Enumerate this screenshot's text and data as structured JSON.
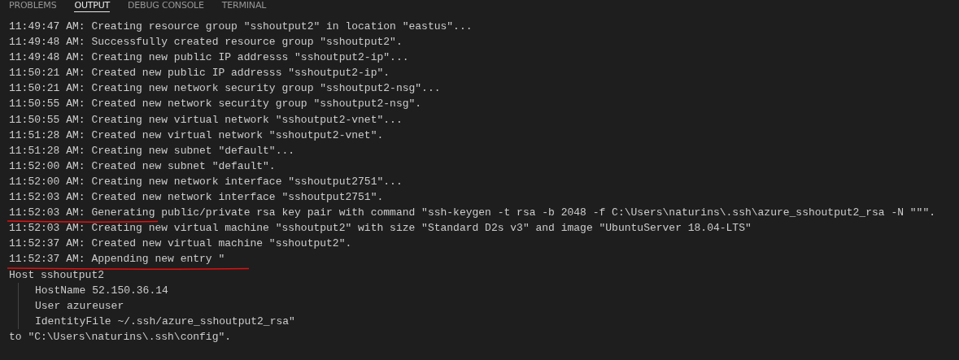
{
  "tabs": [
    {
      "label": "PROBLEMS",
      "selected": false
    },
    {
      "label": "OUTPUT",
      "selected": true
    },
    {
      "label": "DEBUG CONSOLE",
      "selected": false
    },
    {
      "label": "TERMINAL",
      "selected": false
    }
  ],
  "output": {
    "lines": [
      {
        "text": "11:49:47 AM: Creating resource group \"sshoutput2\" in location \"eastus\"...",
        "underlined": false
      },
      {
        "text": "11:49:48 AM: Successfully created resource group \"sshoutput2\".",
        "underlined": false
      },
      {
        "text": "11:49:48 AM: Creating new public IP addresss \"sshoutput2-ip\"...",
        "underlined": false
      },
      {
        "text": "11:50:21 AM: Created new public IP addresss \"sshoutput2-ip\".",
        "underlined": false
      },
      {
        "text": "11:50:21 AM: Creating new network security group \"sshoutput2-nsg\"...",
        "underlined": false
      },
      {
        "text": "11:50:55 AM: Created new network security group \"sshoutput2-nsg\".",
        "underlined": false
      },
      {
        "text": "11:50:55 AM: Creating new virtual network \"sshoutput2-vnet\"...",
        "underlined": false
      },
      {
        "text": "11:51:28 AM: Created new virtual network \"sshoutput2-vnet\".",
        "underlined": false
      },
      {
        "text": "11:51:28 AM: Creating new subnet \"default\"...",
        "underlined": false
      },
      {
        "text": "11:52:00 AM: Created new subnet \"default\".",
        "underlined": false
      },
      {
        "text": "11:52:00 AM: Creating new network interface \"sshoutput2751\"...",
        "underlined": false
      },
      {
        "text": "11:52:03 AM: Created new network interface \"sshoutput2751\".",
        "underlined": false
      },
      {
        "text": "11:52:03 AM: Generating public/private rsa key pair with command \"ssh-keygen -t rsa -b 2048 -f C:\\Users\\naturins\\.ssh\\azure_sshoutput2_rsa -N \"\"\".",
        "underlined": true
      },
      {
        "text": "11:52:03 AM: Creating new virtual machine \"sshoutput2\" with size \"Standard D2s v3\" and image \"UbuntuServer 18.04-LTS\"",
        "underlined": false
      },
      {
        "text": "11:52:37 AM: Created new virtual machine \"sshoutput2\".",
        "underlined": false
      },
      {
        "text": "11:52:37 AM: Appending new entry \"",
        "underlined": true
      },
      {
        "text": "Host sshoutput2",
        "underlined": false,
        "children": [
          {
            "text": "HostName 52.150.36.14",
            "underlined": false
          },
          {
            "text": "User azureuser",
            "underlined": false
          },
          {
            "text": "IdentityFile ~/.ssh/azure_sshoutput2_rsa\"",
            "underlined": false
          }
        ]
      },
      {
        "text": "to \"C:\\Users\\naturins\\.ssh\\config\".",
        "underlined": false
      }
    ]
  }
}
